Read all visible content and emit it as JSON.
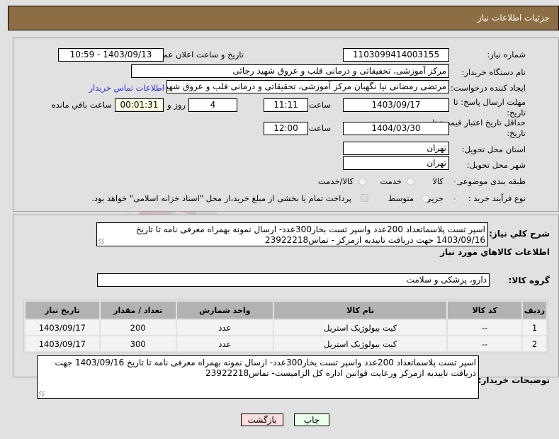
{
  "header": {
    "title": "جزئیات اطلاعات نیاز"
  },
  "form": {
    "need_number": {
      "label": "شماره نیاز:",
      "value": "1103099414003155"
    },
    "announce_datetime": {
      "label": "تاریخ و ساعت اعلان عمومی:",
      "value": "1403/09/13 - 10:59"
    },
    "buyer_org": {
      "label": "نام دستگاه خریدار:",
      "value": "مرکز آموزشی، تحقیقاتی و درمانی قلب و عروق شهید رجائی"
    },
    "requester": {
      "label": "ایجاد کننده درخواست:",
      "value": "مرتضی رمضانی نیا نگهبان مرکز آموزشی، تحقیقاتی و درمانی قلب و عروق شهید رجائی",
      "contact_link": "اطلاعات تماس خریدار"
    },
    "reply_deadline": {
      "label": "مهلت ارسال پاسخ: تا تاریخ:",
      "date": "1403/09/17",
      "time_label": "ساعت",
      "time": "11:11",
      "days": "4",
      "days_label": "روز و",
      "remaining": "00:01:31",
      "remaining_label": "ساعت باقي مانده"
    },
    "price_validity": {
      "label": "حداقل تاریخ اعتبار قیمت: تا تاریخ:",
      "date": "1404/03/30",
      "time_label": "ساعت",
      "time": "12:00"
    },
    "delivery_province": {
      "label": "استان محل تحویل:",
      "value": "تهران"
    },
    "delivery_city": {
      "label": "شهر محل تحویل:",
      "value": "تهران"
    },
    "category": {
      "label": "طبقه بندی موضوعی:",
      "options": [
        "کالا",
        "خدمت",
        "کالا/خدمت"
      ],
      "selected": "کالا"
    },
    "purchase_type": {
      "label": "نوع فرآیند خرید :",
      "options": [
        "جزیي",
        "متوسط"
      ],
      "selected": "جزیي",
      "payment_note": "پرداخت تمام یا بخشی از مبلغ خرید،از محل \"اسناد خزانه اسلامی\" خواهد بود."
    }
  },
  "details": {
    "summary_label": "شرح کلي نیاز:",
    "summary": "اسپر تست پلاسماتعداد 200عدد واسپر تست بخار300عدد- ارسال نمونه بهمراه معرفی نامه تا تاریخ 1403/09/16 جهت دریافت تاییدیه ازمرکز - تماس23922218",
    "items_heading": "اطلاعات کالاهاي مورد نیاز",
    "group_label": "گروه کالا:",
    "group_value": "دارو، پزشکی و سلامت",
    "table": {
      "columns": [
        "ردیف",
        "کد کالا",
        "نام کالا",
        "واحد شمارش",
        "تعداد / مقدار",
        "تاریخ نیاز"
      ],
      "rows": [
        [
          "1",
          "--",
          "کیت بیولوژیک استریل",
          "عدد",
          "200",
          "1403/09/17"
        ],
        [
          "2",
          "--",
          "کیت بیولوژیک استریل",
          "عدد",
          "300",
          "1403/09/17"
        ]
      ]
    },
    "buyer_notes_label": "توضیحات خریدار:",
    "buyer_notes": "اسپر تست پلاسماتعداد 200عدد واسپر تست بخار300عدد- ارسال نمونه بهمراه معرفی نامه تا تاریخ 1403/09/16 جهت دریافت تاییدیه ازمرکز ورعایت قوانین اداره کل الزامیست- تماس23922218"
  },
  "buttons": {
    "print": "چاپ",
    "back": "بازگشت"
  },
  "colors": {
    "header": "#8d6d43",
    "print_bg": "#eaffea",
    "back_bg": "#ffdede",
    "link": "#2a2ad6"
  }
}
